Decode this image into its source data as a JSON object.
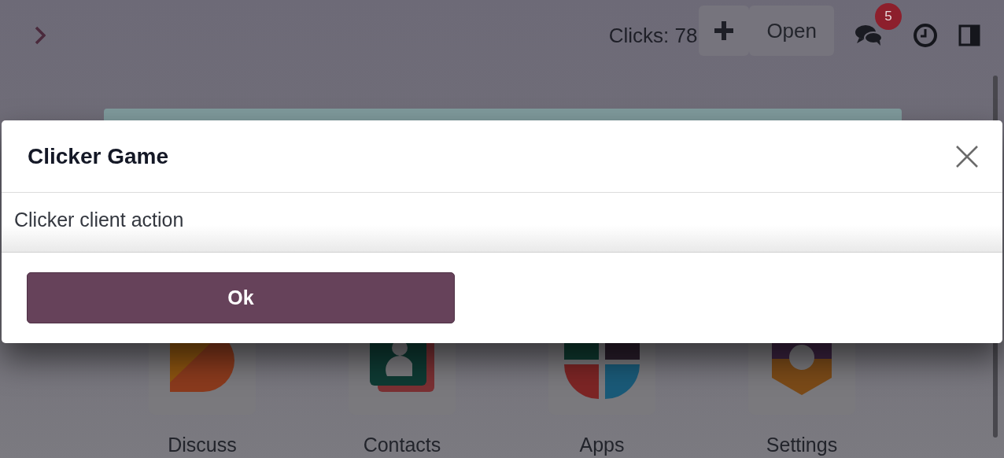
{
  "navbar": {
    "clicks": "Clicks: 78",
    "open_button": "Open",
    "messages_badge": "5"
  },
  "dialog": {
    "title": "Clicker Game",
    "body": "Clicker client action",
    "confirm_button": "Ok"
  },
  "apps": [
    {
      "label": "Discuss",
      "kind": "discuss"
    },
    {
      "label": "Contacts",
      "kind": "contacts"
    },
    {
      "label": "Apps",
      "kind": "apps"
    },
    {
      "label": "Settings",
      "kind": "settings"
    }
  ]
}
